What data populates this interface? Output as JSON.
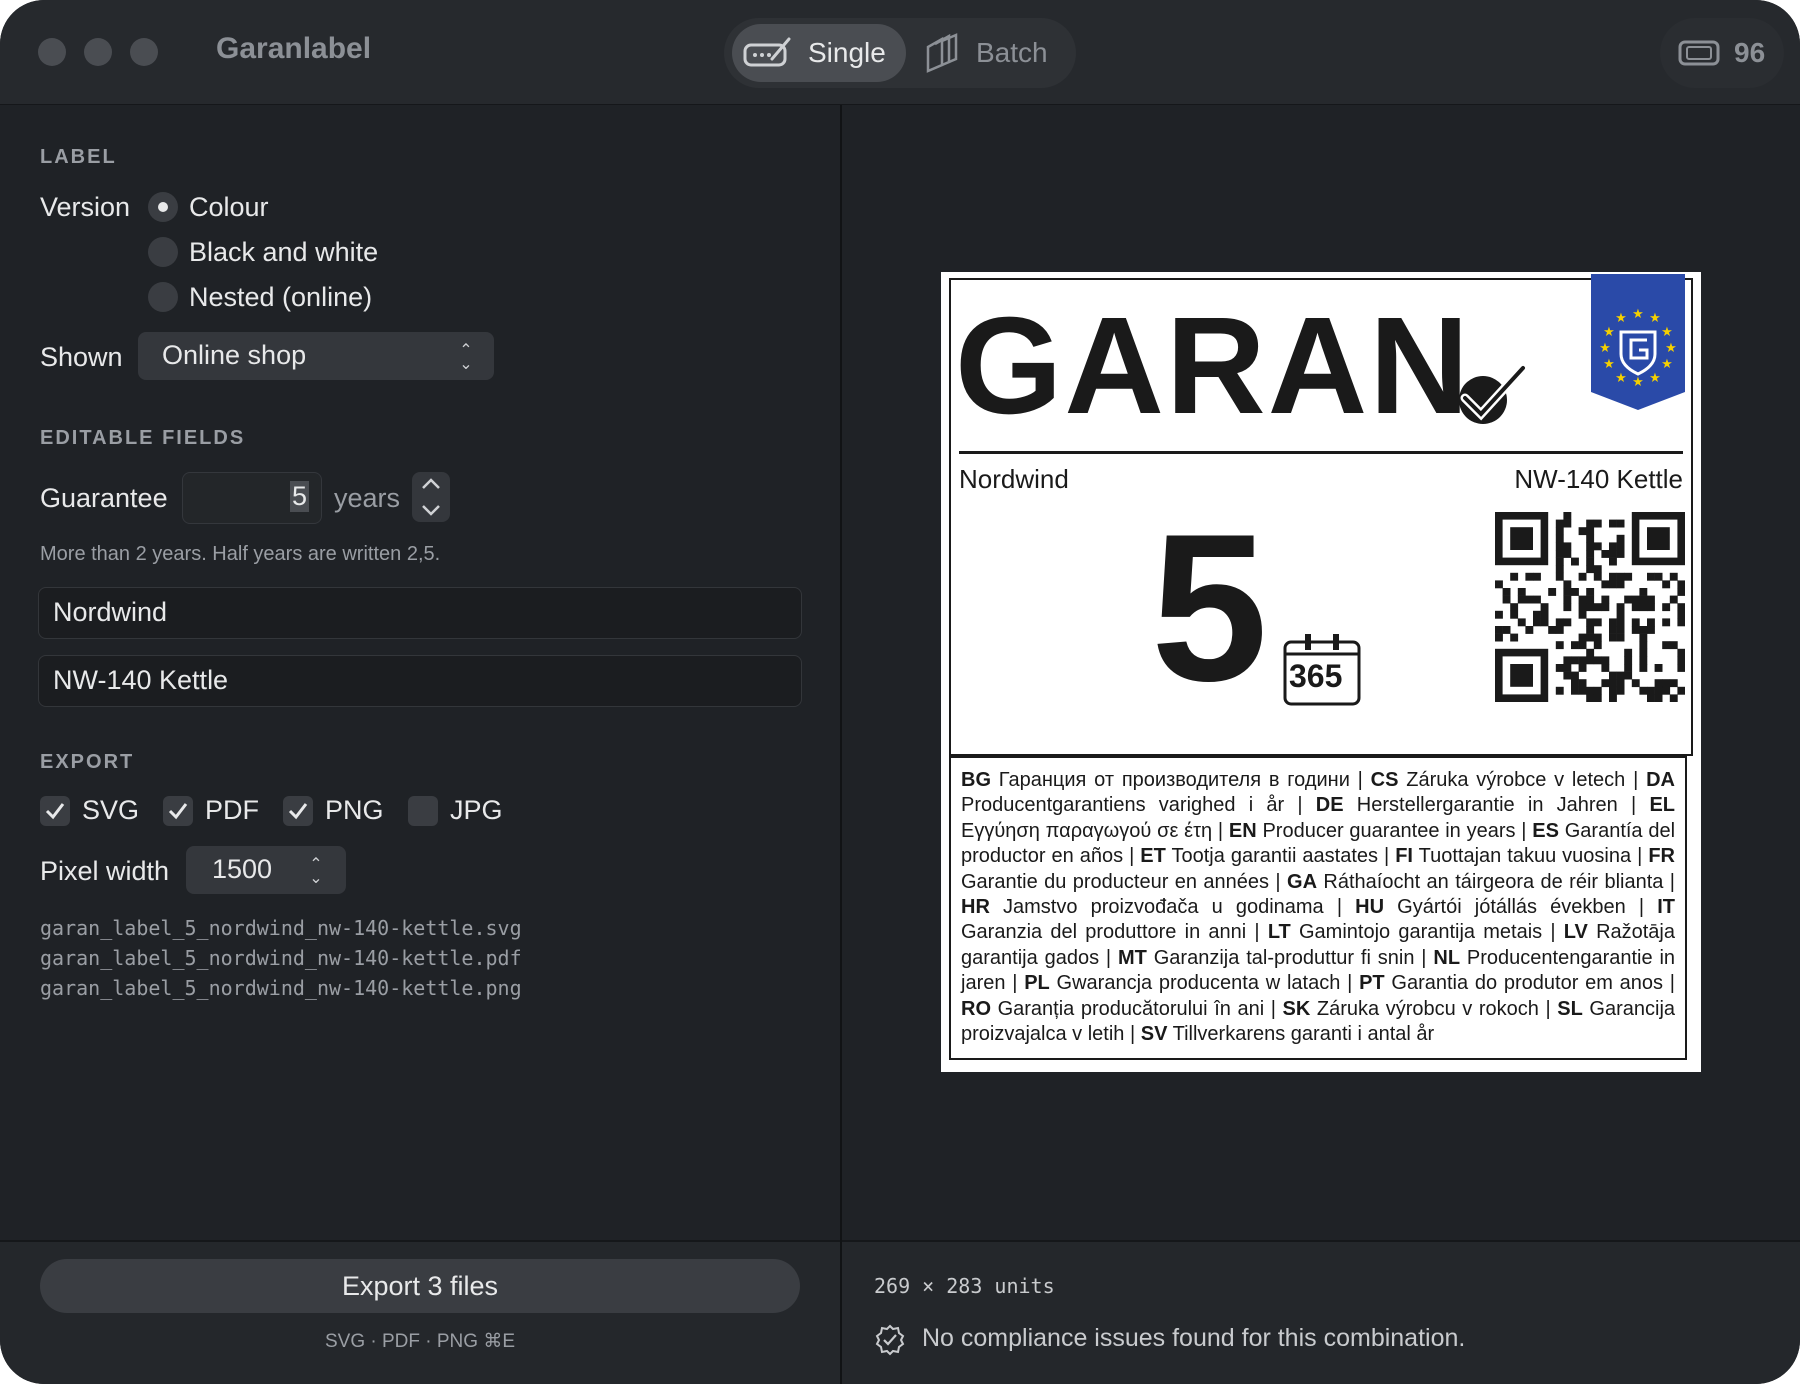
{
  "window": {
    "title": "Garanlabel"
  },
  "mode": {
    "single_label": "Single",
    "batch_label": "Batch"
  },
  "credits": {
    "count": "96"
  },
  "label_section": {
    "heading": "LABEL",
    "version_label": "Version",
    "versions": [
      "Colour",
      "Black and white",
      "Nested (online)"
    ],
    "selected_version": "Colour",
    "shown_label": "Shown",
    "shown_value": "Online shop"
  },
  "fields_section": {
    "heading": "EDITABLE FIELDS",
    "guarantee_label": "Guarantee",
    "guarantee_value": "5",
    "guarantee_unit": "years",
    "hint": "More than 2 years. Half years are written 2,5.",
    "brand_value": "Nordwind",
    "model_value": "NW-140 Kettle"
  },
  "export_section": {
    "heading": "EXPORT",
    "formats": [
      {
        "label": "SVG",
        "checked": true
      },
      {
        "label": "PDF",
        "checked": true
      },
      {
        "label": "PNG",
        "checked": true
      },
      {
        "label": "JPG",
        "checked": false
      }
    ],
    "pixel_width_label": "Pixel width",
    "pixel_width_value": "1500",
    "files": [
      "garan_label_5_nordwind_nw-140-kettle.svg",
      "garan_label_5_nordwind_nw-140-kettle.pdf",
      "garan_label_5_nordwind_nw-140-kettle.png"
    ],
    "button_label": "Export 3 files",
    "button_sub": "SVG · PDF · PNG   ⌘E"
  },
  "preview": {
    "logo_text": "GARAN",
    "brand": "Nordwind",
    "model": "NW-140 Kettle",
    "years": "5",
    "calendar_number": "365",
    "translations": [
      {
        "code": "BG",
        "text": "Гаранция от производителя в години"
      },
      {
        "code": "CS",
        "text": "Záruka výrobce v letech"
      },
      {
        "code": "DA",
        "text": "Producentgarantiens varighed i år"
      },
      {
        "code": "DE",
        "text": "Herstellergarantie in Jahren"
      },
      {
        "code": "EL",
        "text": "Εγγύηση παραγωγού σε έτη"
      },
      {
        "code": "EN",
        "text": "Producer guarantee in years"
      },
      {
        "code": "ES",
        "text": "Garantía del productor en años"
      },
      {
        "code": "ET",
        "text": "Tootja garantii aastates"
      },
      {
        "code": "FI",
        "text": "Tuottajan takuu vuosina"
      },
      {
        "code": "FR",
        "text": "Garantie du producteur en années"
      },
      {
        "code": "GA",
        "text": "Ráthaíocht an táirgeora de réir blianta"
      },
      {
        "code": "HR",
        "text": "Jamstvo proizvođača u godinama"
      },
      {
        "code": "HU",
        "text": "Gyártói jótállás években"
      },
      {
        "code": "IT",
        "text": "Garanzia del produttore in anni"
      },
      {
        "code": "LT",
        "text": "Gamintojo garantija metais"
      },
      {
        "code": "LV",
        "text": "Ražotāja garantija gados"
      },
      {
        "code": "MT",
        "text": "Garanzija tal-produttur fi snin"
      },
      {
        "code": "NL",
        "text": "Producentengarantie in jaren"
      },
      {
        "code": "PL",
        "text": "Gwarancja producenta w latach"
      },
      {
        "code": "PT",
        "text": "Garantia do produtor em anos"
      },
      {
        "code": "RO",
        "text": "Garanția producătorului în ani"
      },
      {
        "code": "SK",
        "text": "Záruka výrobcu v rokoch"
      },
      {
        "code": "SL",
        "text": "Garancija proizvajalca v letih"
      },
      {
        "code": "SV",
        "text": "Tillverkarens garanti i antal år"
      }
    ]
  },
  "status": {
    "dimensions": "269 × 283 units",
    "compliance": "No compliance issues found for this combination."
  },
  "colors": {
    "window_bg": "#1f2226",
    "titlebar_bg": "#26292d",
    "eu_blue": "#2a4aa8",
    "eu_star": "#f5d000"
  }
}
